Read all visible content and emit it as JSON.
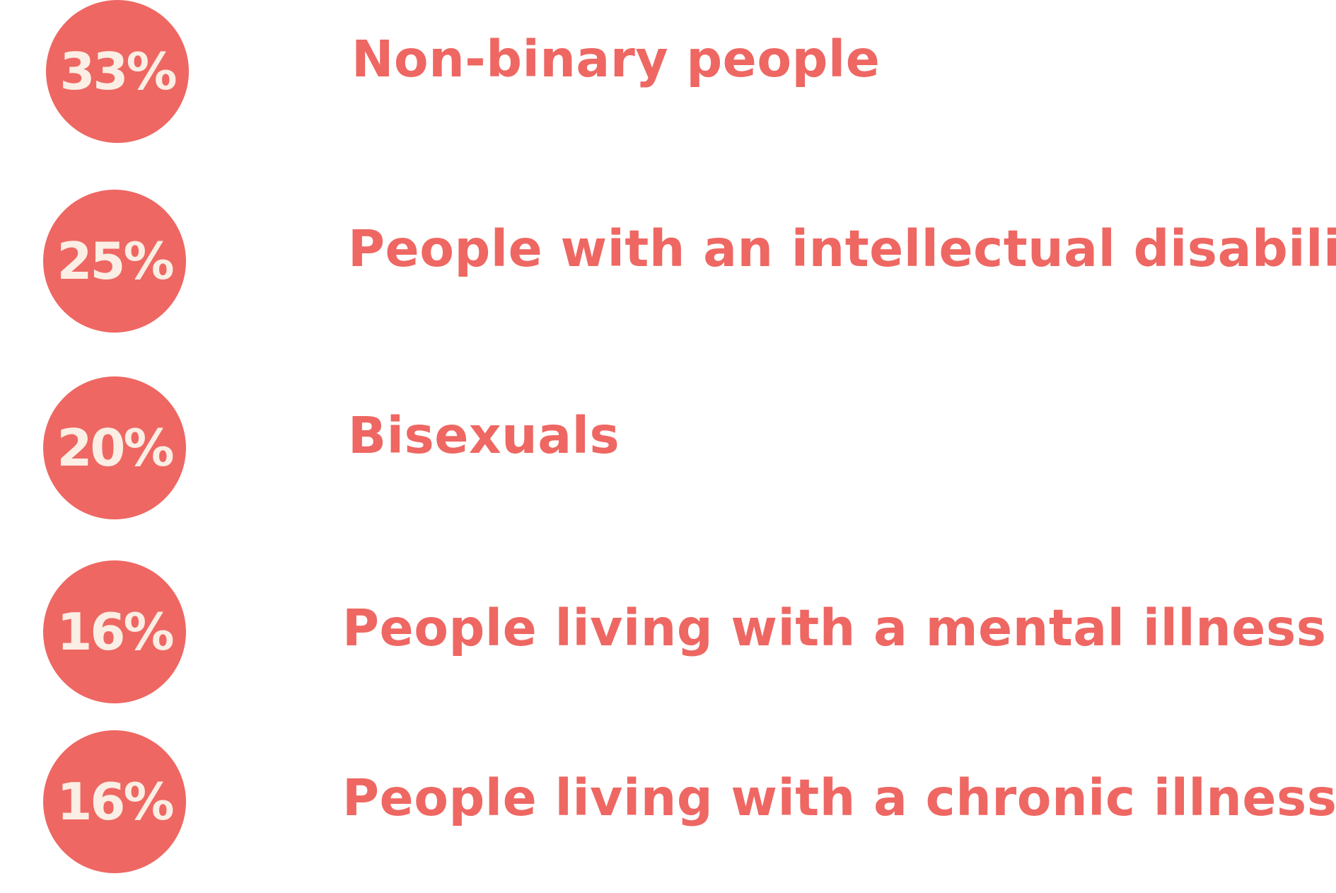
{
  "colors": {
    "accent": "#EE6762",
    "circle_text": "#FBEEE4",
    "background": "#FFFFFF"
  },
  "chart_data": {
    "type": "table",
    "title": "",
    "categories": [
      "Non-binary people",
      "People with an intellectual disability",
      "Bisexuals",
      "People living with a mental illness",
      "People living with a chronic illness"
    ],
    "values": [
      33,
      25,
      20,
      16,
      16
    ],
    "value_labels": [
      "33%",
      "25%",
      "20%",
      "16%",
      "16%"
    ],
    "unit": "%"
  }
}
